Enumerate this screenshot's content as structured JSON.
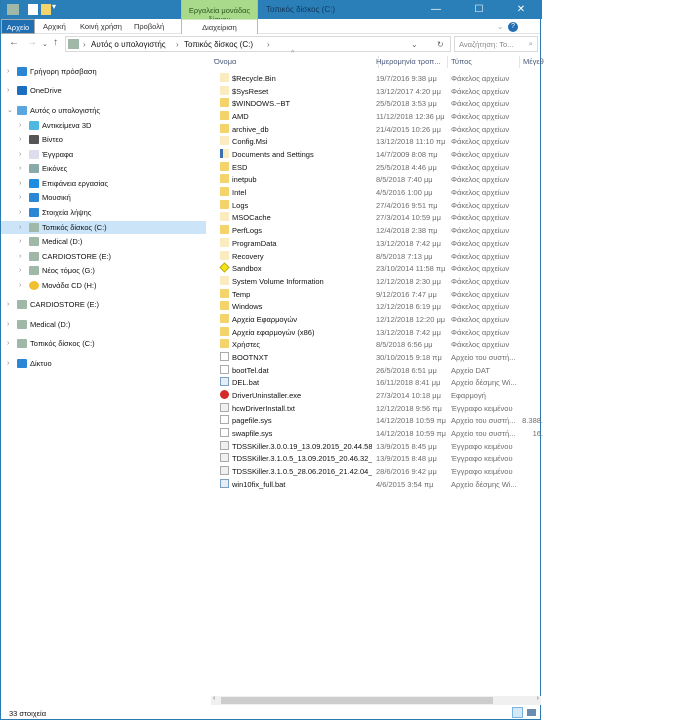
{
  "window": {
    "title": "Τοπικός δίσκος (C:)",
    "tool_tab": "Εργαλεία μονάδας δίσκου",
    "tool_subtab": "Διαχείριση",
    "accent": "#2b7fb8"
  },
  "ribbon": {
    "tabs": [
      "Αρχείο",
      "Αρχική",
      "Κοινή χρήση",
      "Προβολή"
    ]
  },
  "address": {
    "crumbs": [
      "Αυτός ο υπολογιστής",
      "Τοπικός δίσκος (C:)"
    ],
    "search_placeholder": "Αναζήτηση: Το..."
  },
  "sidebar": [
    {
      "label": "Γρήγορη πρόσβαση",
      "icon": "star-icon",
      "level": 0
    },
    {
      "label": "OneDrive",
      "icon": "cloud-icon",
      "level": 0
    },
    {
      "label": "Αυτός ο υπολογιστής",
      "icon": "computer-icon",
      "level": 0,
      "expanded": true
    },
    {
      "label": "Αντικείμενα 3D",
      "icon": "cube-icon",
      "level": 1
    },
    {
      "label": "Βίντεο",
      "icon": "video-icon",
      "level": 1
    },
    {
      "label": "Έγγραφα",
      "icon": "document-icon",
      "level": 1
    },
    {
      "label": "Εικόνες",
      "icon": "pictures-icon",
      "level": 1
    },
    {
      "label": "Επιφάνεια εργασίας",
      "icon": "desktop-icon",
      "level": 1
    },
    {
      "label": "Μουσική",
      "icon": "music-icon",
      "level": 1
    },
    {
      "label": "Στοιχεία λήψης",
      "icon": "download-icon",
      "level": 1
    },
    {
      "label": "Τοπικός δίσκος (C:)",
      "icon": "drive-icon",
      "level": 1,
      "selected": true
    },
    {
      "label": "Medical (D:)",
      "icon": "drive-icon",
      "level": 1
    },
    {
      "label": "CARDIOSTORE (E:)",
      "icon": "drive-icon",
      "level": 1
    },
    {
      "label": "Νέος τόμος (G:)",
      "icon": "drive-icon",
      "level": 1
    },
    {
      "label": "Μονάδα CD (H:)",
      "icon": "cd-icon",
      "level": 1
    },
    {
      "label": "CARDIOSTORE (E:)",
      "icon": "drive-icon",
      "level": 0
    },
    {
      "label": "Medical (D:)",
      "icon": "drive-icon",
      "level": 0
    },
    {
      "label": "Τοπικός δίσκος (C:)",
      "icon": "drive-icon",
      "level": 0
    },
    {
      "label": "Δίκτυο",
      "icon": "network-icon",
      "level": 0
    }
  ],
  "columns": [
    "Όνομα",
    "Ημερομηνία τροπ...",
    "Τύπος",
    "Μέγεθ"
  ],
  "files": [
    {
      "name": "$Recycle.Bin",
      "date": "19/7/2016 9:38 μμ",
      "type": "Φάκελος αρχείων",
      "size": "",
      "kind": "folder-hidden"
    },
    {
      "name": "$SysReset",
      "date": "13/12/2017 4:20 μμ",
      "type": "Φάκελος αρχείων",
      "size": "",
      "kind": "folder-hidden"
    },
    {
      "name": "$WINDOWS.~BT",
      "date": "25/5/2018 3:53 μμ",
      "type": "Φάκελος αρχείων",
      "size": "",
      "kind": "folder"
    },
    {
      "name": "AMD",
      "date": "11/12/2018 12:36 μμ",
      "type": "Φάκελος αρχείων",
      "size": "",
      "kind": "folder"
    },
    {
      "name": "archive_db",
      "date": "21/4/2015 10:26 μμ",
      "type": "Φάκελος αρχείων",
      "size": "",
      "kind": "folder"
    },
    {
      "name": "Config.Msi",
      "date": "13/12/2018 11:10 πμ",
      "type": "Φάκελος αρχείων",
      "size": "",
      "kind": "folder-hidden"
    },
    {
      "name": "Documents and Settings",
      "date": "14/7/2009 8:08 πμ",
      "type": "Φάκελος αρχείων",
      "size": "",
      "kind": "shortcut"
    },
    {
      "name": "ESD",
      "date": "25/5/2018 4:46 μμ",
      "type": "Φάκελος αρχείων",
      "size": "",
      "kind": "folder"
    },
    {
      "name": "inetpub",
      "date": "8/5/2018 7:40 μμ",
      "type": "Φάκελος αρχείων",
      "size": "",
      "kind": "folder"
    },
    {
      "name": "Intel",
      "date": "4/5/2016 1:00 μμ",
      "type": "Φάκελος αρχείων",
      "size": "",
      "kind": "folder"
    },
    {
      "name": "Logs",
      "date": "27/4/2016 9:51 πμ",
      "type": "Φάκελος αρχείων",
      "size": "",
      "kind": "folder"
    },
    {
      "name": "MSOCache",
      "date": "27/3/2014 10:59 μμ",
      "type": "Φάκελος αρχείων",
      "size": "",
      "kind": "folder-hidden"
    },
    {
      "name": "PerfLogs",
      "date": "12/4/2018 2:38 πμ",
      "type": "Φάκελος αρχείων",
      "size": "",
      "kind": "folder"
    },
    {
      "name": "ProgramData",
      "date": "13/12/2018 7:42 μμ",
      "type": "Φάκελος αρχείων",
      "size": "",
      "kind": "folder-hidden"
    },
    {
      "name": "Recovery",
      "date": "8/5/2018 7:13 μμ",
      "type": "Φάκελος αρχείων",
      "size": "",
      "kind": "folder-hidden"
    },
    {
      "name": "Sandbox",
      "date": "23/10/2014 11:58 πμ",
      "type": "Φάκελος αρχείων",
      "size": "",
      "kind": "sandbox"
    },
    {
      "name": "System Volume Information",
      "date": "12/12/2018 2:30 μμ",
      "type": "Φάκελος αρχείων",
      "size": "",
      "kind": "folder-hidden"
    },
    {
      "name": "Temp",
      "date": "9/12/2016 7:47 μμ",
      "type": "Φάκελος αρχείων",
      "size": "",
      "kind": "folder"
    },
    {
      "name": "Windows",
      "date": "12/12/2018 6:19 μμ",
      "type": "Φάκελος αρχείων",
      "size": "",
      "kind": "folder"
    },
    {
      "name": "Αρχεία Εφαρμογών",
      "date": "12/12/2018 12:20 μμ",
      "type": "Φάκελος αρχείων",
      "size": "",
      "kind": "folder"
    },
    {
      "name": "Αρχεία εφαρμογών (x86)",
      "date": "13/12/2018 7:42 μμ",
      "type": "Φάκελος αρχείων",
      "size": "",
      "kind": "folder"
    },
    {
      "name": "Χρήστες",
      "date": "8/5/2018 6:56 μμ",
      "type": "Φάκελος αρχείων",
      "size": "",
      "kind": "folder"
    },
    {
      "name": "BOOTNXT",
      "date": "30/10/2015 9:18 πμ",
      "type": "Αρχείο του συστή...",
      "size": "",
      "kind": "sysfile"
    },
    {
      "name": "bootTel.dat",
      "date": "26/5/2018 6:51 μμ",
      "type": "Αρχείο DAT",
      "size": "",
      "kind": "file"
    },
    {
      "name": "DEL.bat",
      "date": "16/11/2018 8:41 μμ",
      "type": "Αρχείο δέσμης Wi...",
      "size": "",
      "kind": "bat"
    },
    {
      "name": "DriverUninstaller.exe",
      "date": "27/3/2014 10:18 μμ",
      "type": "Εφαρμογή",
      "size": "",
      "kind": "exe"
    },
    {
      "name": "hcwDriverInstall.txt",
      "date": "12/12/2018 9:56 πμ",
      "type": "Έγγραφο κειμένου",
      "size": "",
      "kind": "txt"
    },
    {
      "name": "pagefile.sys",
      "date": "14/12/2018 10:59 πμ",
      "type": "Αρχείο του συστή...",
      "size": "8.388.",
      "kind": "sysfile"
    },
    {
      "name": "swapfile.sys",
      "date": "14/12/2018 10:59 πμ",
      "type": "Αρχείο του συστή...",
      "size": "16.",
      "kind": "sysfile"
    },
    {
      "name": "TDSSKiller.3.0.0.19_13.09.2015_20.44.58_lo...",
      "date": "13/9/2015 8:45 μμ",
      "type": "Έγγραφο κειμένου",
      "size": "",
      "kind": "txt"
    },
    {
      "name": "TDSSKiller.3.1.0.5_13.09.2015_20.46.32_log...",
      "date": "13/9/2015 8:48 μμ",
      "type": "Έγγραφο κειμένου",
      "size": "",
      "kind": "txt"
    },
    {
      "name": "TDSSKiller.3.1.0.5_28.06.2016_21.42.04_log...",
      "date": "28/6/2016 9:42 μμ",
      "type": "Έγγραφο κειμένου",
      "size": "",
      "kind": "txt"
    },
    {
      "name": "win10fix_full.bat",
      "date": "4/6/2015 3:54 πμ",
      "type": "Αρχείο δέσμης Wi...",
      "size": "",
      "kind": "bat"
    }
  ],
  "status": {
    "count": "33 στοιχεία"
  }
}
